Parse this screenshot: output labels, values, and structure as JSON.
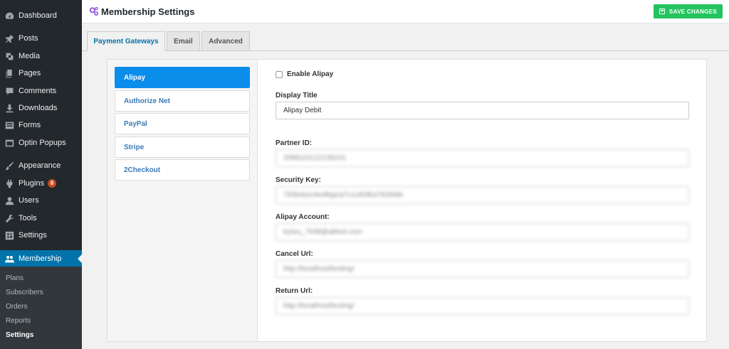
{
  "sidebar": {
    "items": [
      {
        "label": "Dashboard",
        "icon": "dashboard-icon"
      },
      {
        "label": "Posts",
        "icon": "pin-icon"
      },
      {
        "label": "Media",
        "icon": "media-icon"
      },
      {
        "label": "Pages",
        "icon": "pages-icon"
      },
      {
        "label": "Comments",
        "icon": "comment-icon"
      },
      {
        "label": "Downloads",
        "icon": "download-icon"
      },
      {
        "label": "Forms",
        "icon": "forms-icon"
      },
      {
        "label": "Optin Popups",
        "icon": "popup-icon"
      },
      {
        "label": "Appearance",
        "icon": "brush-icon"
      },
      {
        "label": "Plugins",
        "icon": "plugin-icon",
        "badge": "6"
      },
      {
        "label": "Users",
        "icon": "user-icon"
      },
      {
        "label": "Tools",
        "icon": "wrench-icon"
      },
      {
        "label": "Settings",
        "icon": "settings-icon"
      },
      {
        "label": "Membership",
        "icon": "membership-icon"
      }
    ],
    "submenu": [
      "Plans",
      "Subscribers",
      "Orders",
      "Reports",
      "Settings"
    ]
  },
  "header": {
    "title": "Membership Settings",
    "save_label": "SAVE CHANGES"
  },
  "tabs": [
    "Payment Gateways",
    "Email",
    "Advanced"
  ],
  "gateways": [
    "Alipay",
    "Authorize Net",
    "PayPal",
    "Stripe",
    "2Checkout"
  ],
  "form": {
    "enable_label": "Enable Alipay",
    "display_title_label": "Display Title",
    "display_title_value": "Alipay Debit",
    "partner_id_label": "Partner ID:",
    "partner_id_value": "2088101122136241",
    "security_key_label": "Security Key:",
    "security_key_value": "760bdzec6edfqqca7c1u60l6zi7b2bfde",
    "account_label": "Alipay Account:",
    "account_value": "kyiwu_7638@alitest.com",
    "cancel_url_label": "Cancel Url:",
    "cancel_url_value": "http://localhost/testing/",
    "return_url_label": "Return Url:",
    "return_url_value": "http://localhost/testing/"
  },
  "colors": {
    "sidebar_bg": "#23282d",
    "active_menu": "#0073aa",
    "save_button": "#23c45f",
    "active_gateway": "#0b8dec",
    "plugin_badge": "#ca4a1f"
  }
}
